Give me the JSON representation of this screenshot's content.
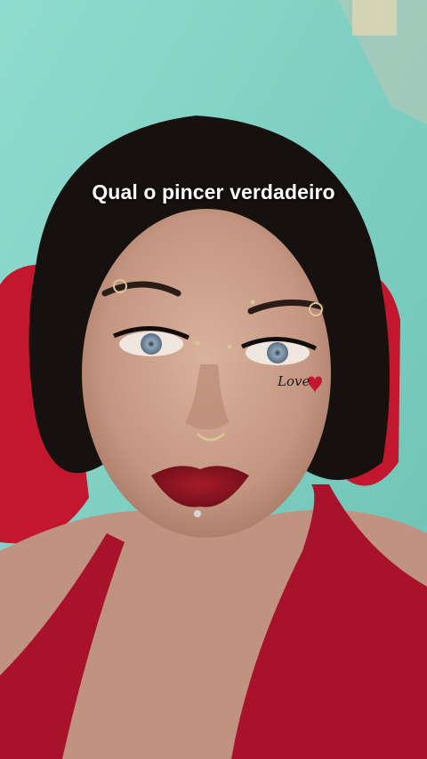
{
  "overlay": {
    "caption": "Qual o pincer verdadeiro",
    "sticker_text": "Love"
  },
  "colors": {
    "wall": "#7fd3c6",
    "pillow": "#c3172f",
    "top": "#a8122a",
    "hair": "#16110f",
    "skin": "#c9a08a",
    "lips": "#8f1522",
    "caption_text": "#ffffff"
  }
}
